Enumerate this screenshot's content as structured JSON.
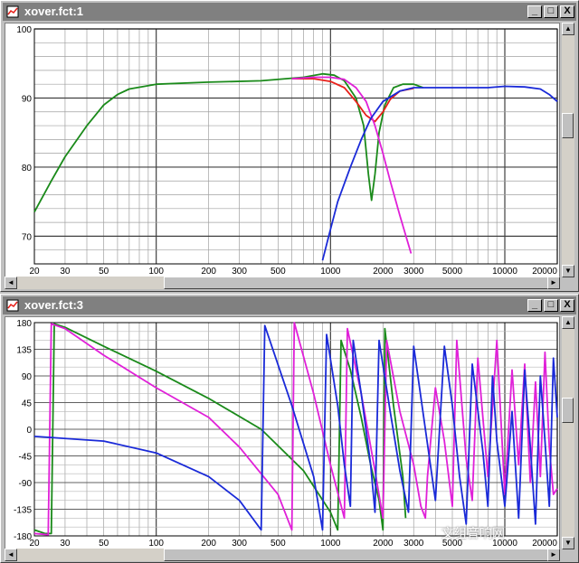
{
  "windows": [
    {
      "title": "xover.fct:1"
    },
    {
      "title": "xover.fct:3"
    }
  ],
  "window_buttons": {
    "minimize": "_",
    "maximize": "□",
    "close": "X"
  },
  "watermark": "文组音响网",
  "colors": {
    "green": "#1a8a1a",
    "red": "#e8201a",
    "magenta": "#e020d8",
    "blue": "#1a2ad8",
    "grid": "#808080"
  },
  "chart_data": [
    {
      "type": "line",
      "x_scale": "log",
      "xlim": [
        20,
        20000
      ],
      "ylim": [
        66,
        100
      ],
      "x_ticks": [
        20,
        30,
        50,
        100,
        200,
        300,
        500,
        1000,
        2000,
        3000,
        5000,
        10000,
        20000
      ],
      "x_tick_labels": [
        "20",
        "30",
        "50",
        "100",
        "200",
        "300",
        "500",
        "1000",
        "2000",
        "3000",
        "5000",
        "10000",
        "20000"
      ],
      "y_ticks": [
        70,
        80,
        90,
        100
      ],
      "y_tick_labels": [
        "70",
        "80",
        "90",
        "100"
      ],
      "grid": true,
      "series": [
        {
          "color": "#1a8a1a",
          "points": [
            [
              20,
              73.5
            ],
            [
              25,
              78
            ],
            [
              30,
              81.5
            ],
            [
              40,
              86
            ],
            [
              50,
              89
            ],
            [
              60,
              90.5
            ],
            [
              70,
              91.3
            ],
            [
              100,
              92
            ],
            [
              200,
              92.3
            ],
            [
              400,
              92.5
            ],
            [
              700,
              93
            ],
            [
              900,
              93.5
            ],
            [
              1050,
              93.3
            ],
            [
              1200,
              92.5
            ],
            [
              1400,
              90
            ],
            [
              1550,
              86
            ],
            [
              1650,
              79
            ],
            [
              1720,
              75.2
            ],
            [
              1800,
              79
            ],
            [
              1900,
              85
            ],
            [
              2050,
              89
            ],
            [
              2300,
              91.5
            ],
            [
              2600,
              92
            ],
            [
              3000,
              92
            ],
            [
              3400,
              91.5
            ]
          ]
        },
        {
          "color": "#e8201a",
          "points": [
            [
              600,
              92.8
            ],
            [
              800,
              92.8
            ],
            [
              1000,
              92.4
            ],
            [
              1200,
              91.5
            ],
            [
              1400,
              89.5
            ],
            [
              1600,
              87.5
            ],
            [
              1800,
              86.6
            ],
            [
              2000,
              88
            ],
            [
              2200,
              89.8
            ],
            [
              2500,
              91
            ],
            [
              3000,
              91.4
            ]
          ]
        },
        {
          "color": "#e020d8",
          "points": [
            [
              600,
              92.8
            ],
            [
              800,
              93
            ],
            [
              1000,
              93
            ],
            [
              1200,
              92.7
            ],
            [
              1400,
              91.5
            ],
            [
              1600,
              89.5
            ],
            [
              1800,
              86
            ],
            [
              2000,
              82
            ],
            [
              2200,
              78
            ],
            [
              2500,
              73
            ],
            [
              2900,
              67.5
            ]
          ]
        },
        {
          "color": "#1a2ad8",
          "points": [
            [
              900,
              66.5
            ],
            [
              1000,
              71
            ],
            [
              1100,
              75
            ],
            [
              1300,
              80
            ],
            [
              1500,
              84
            ],
            [
              1700,
              87
            ],
            [
              2000,
              89.5
            ],
            [
              2500,
              91
            ],
            [
              3000,
              91.5
            ],
            [
              4000,
              91.5
            ],
            [
              6000,
              91.5
            ],
            [
              8000,
              91.5
            ],
            [
              10000,
              91.7
            ],
            [
              13000,
              91.6
            ],
            [
              16000,
              91.3
            ],
            [
              18000,
              90.5
            ],
            [
              20000,
              89.5
            ]
          ]
        }
      ]
    },
    {
      "type": "line",
      "x_scale": "log",
      "xlim": [
        20,
        20000
      ],
      "ylim": [
        -180,
        180
      ],
      "x_ticks": [
        20,
        30,
        50,
        100,
        200,
        300,
        500,
        1000,
        2000,
        3000,
        5000,
        10000,
        20000
      ],
      "x_tick_labels": [
        "20",
        "30",
        "50",
        "100",
        "200",
        "300",
        "500",
        "1000",
        "2000",
        "3000",
        "5000",
        "10000",
        "20000"
      ],
      "y_ticks": [
        180,
        135,
        90,
        45,
        0,
        -45,
        -90,
        -135,
        -180
      ],
      "y_tick_labels": [
        "180",
        "135",
        "90",
        "45",
        "0",
        "-45",
        "-90",
        "-135",
        "-180"
      ],
      "grid": true,
      "series": [
        {
          "color": "#1a8a1a",
          "points": [
            [
              20,
              -170
            ],
            [
              23,
              -176
            ],
            [
              25,
              -176
            ],
            [
              26,
              178
            ],
            [
              30,
              172
            ],
            [
              50,
              140
            ],
            [
              100,
              98
            ],
            [
              200,
              52
            ],
            [
              400,
              0
            ],
            [
              700,
              -70
            ],
            [
              1000,
              -140
            ],
            [
              1100,
              -170
            ],
            [
              1150,
              150
            ],
            [
              1300,
              100
            ],
            [
              1500,
              20
            ],
            [
              1700,
              -60
            ],
            [
              1900,
              -120
            ],
            [
              2000,
              -170
            ],
            [
              2050,
              170
            ],
            [
              2300,
              40
            ],
            [
              2600,
              -80
            ],
            [
              2700,
              -150
            ]
          ]
        },
        {
          "color": "#e020d8",
          "points": [
            [
              20,
              -176
            ],
            [
              24,
              -178
            ],
            [
              25,
              178
            ],
            [
              30,
              170
            ],
            [
              50,
              125
            ],
            [
              100,
              70
            ],
            [
              200,
              20
            ],
            [
              300,
              -30
            ],
            [
              500,
              -110
            ],
            [
              600,
              -170
            ],
            [
              620,
              180
            ],
            [
              800,
              60
            ],
            [
              1000,
              -60
            ],
            [
              1200,
              -150
            ],
            [
              1250,
              170
            ],
            [
              1500,
              60
            ],
            [
              1800,
              -70
            ],
            [
              2000,
              -150
            ],
            [
              2100,
              150
            ],
            [
              2500,
              30
            ],
            [
              3000,
              -60
            ],
            [
              3300,
              -130
            ],
            [
              3500,
              -150
            ],
            [
              3600,
              -80
            ],
            [
              4000,
              70
            ],
            [
              4500,
              -20
            ],
            [
              5000,
              -130
            ],
            [
              5300,
              150
            ],
            [
              6000,
              -50
            ],
            [
              6500,
              -120
            ],
            [
              7000,
              120
            ],
            [
              8000,
              -80
            ],
            [
              9000,
              150
            ],
            [
              10000,
              -110
            ],
            [
              11000,
              100
            ],
            [
              12000,
              -60
            ],
            [
              13000,
              110
            ],
            [
              14000,
              -90
            ],
            [
              15000,
              80
            ],
            [
              16000,
              -80
            ],
            [
              17000,
              130
            ],
            [
              18000,
              -30
            ],
            [
              19000,
              -110
            ],
            [
              20000,
              -100
            ]
          ]
        },
        {
          "color": "#1a2ad8",
          "points": [
            [
              20,
              -12
            ],
            [
              50,
              -20
            ],
            [
              100,
              -40
            ],
            [
              200,
              -80
            ],
            [
              300,
              -120
            ],
            [
              400,
              -170
            ],
            [
              420,
              175
            ],
            [
              600,
              40
            ],
            [
              800,
              -80
            ],
            [
              900,
              -170
            ],
            [
              950,
              160
            ],
            [
              1100,
              40
            ],
            [
              1200,
              -60
            ],
            [
              1300,
              -130
            ],
            [
              1350,
              150
            ],
            [
              1500,
              60
            ],
            [
              1700,
              -60
            ],
            [
              1800,
              -140
            ],
            [
              1900,
              150
            ],
            [
              2200,
              30
            ],
            [
              2500,
              -70
            ],
            [
              2800,
              -140
            ],
            [
              3000,
              140
            ],
            [
              3500,
              0
            ],
            [
              4000,
              -120
            ],
            [
              4500,
              140
            ],
            [
              5000,
              40
            ],
            [
              5500,
              -80
            ],
            [
              6000,
              -160
            ],
            [
              6500,
              110
            ],
            [
              7500,
              -40
            ],
            [
              8000,
              -130
            ],
            [
              8500,
              90
            ],
            [
              9000,
              -20
            ],
            [
              10000,
              -130
            ],
            [
              11000,
              30
            ],
            [
              12000,
              -150
            ],
            [
              13000,
              100
            ],
            [
              14000,
              -30
            ],
            [
              15000,
              -160
            ],
            [
              16000,
              90
            ],
            [
              17000,
              -20
            ],
            [
              18000,
              -130
            ],
            [
              19000,
              120
            ],
            [
              20000,
              20
            ]
          ]
        }
      ]
    }
  ]
}
